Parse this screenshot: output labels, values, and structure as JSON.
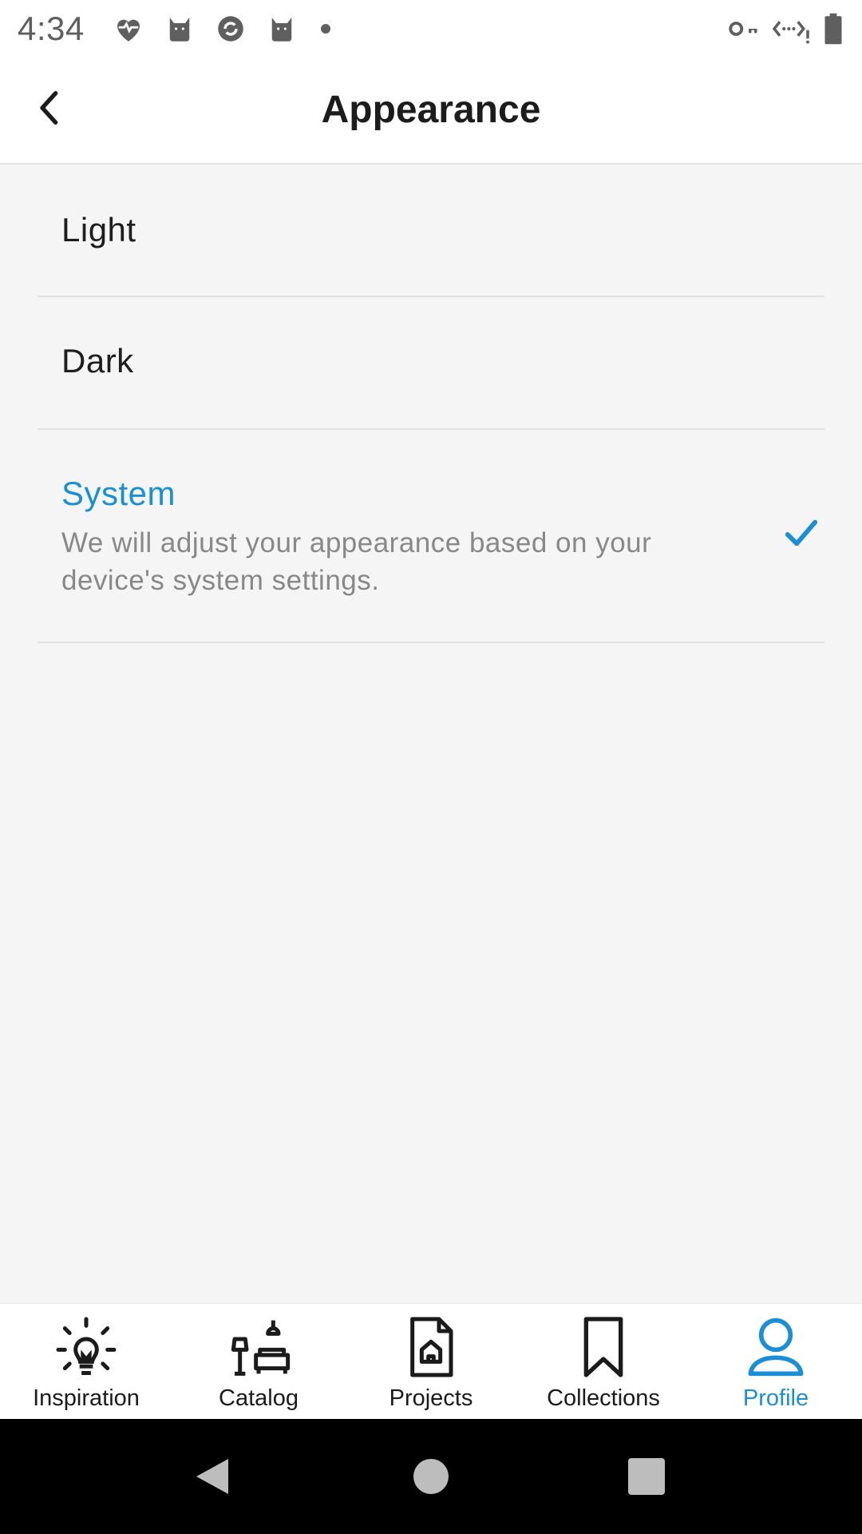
{
  "status_bar": {
    "time": "4:34",
    "notification_icons": [
      "health-heart-icon",
      "cat-icon",
      "sync-icon",
      "cat-icon",
      "dot-icon"
    ],
    "right_icons": [
      "vpn-key-icon",
      "data-transfer-icon",
      "battery-icon"
    ]
  },
  "header": {
    "title": "Appearance",
    "back_icon": "chevron-left-icon"
  },
  "options": [
    {
      "label": "Light",
      "selected": false
    },
    {
      "label": "Dark",
      "selected": false
    },
    {
      "label": "System",
      "description": "We will adjust your appearance based on your device's system settings.",
      "selected": true
    }
  ],
  "bottom_nav": {
    "items": [
      {
        "label": "Inspiration",
        "icon": "lightbulb-icon",
        "active": false
      },
      {
        "label": "Catalog",
        "icon": "furniture-icon",
        "active": false
      },
      {
        "label": "Projects",
        "icon": "project-document-icon",
        "active": false
      },
      {
        "label": "Collections",
        "icon": "bookmark-icon",
        "active": false
      },
      {
        "label": "Profile",
        "icon": "profile-icon",
        "active": true
      }
    ]
  },
  "colors": {
    "accent": "#1a8fd6",
    "background": "#f5f5f5",
    "divider": "#e1e1e1",
    "text_primary": "#1e1e1e",
    "text_secondary": "#888888"
  }
}
